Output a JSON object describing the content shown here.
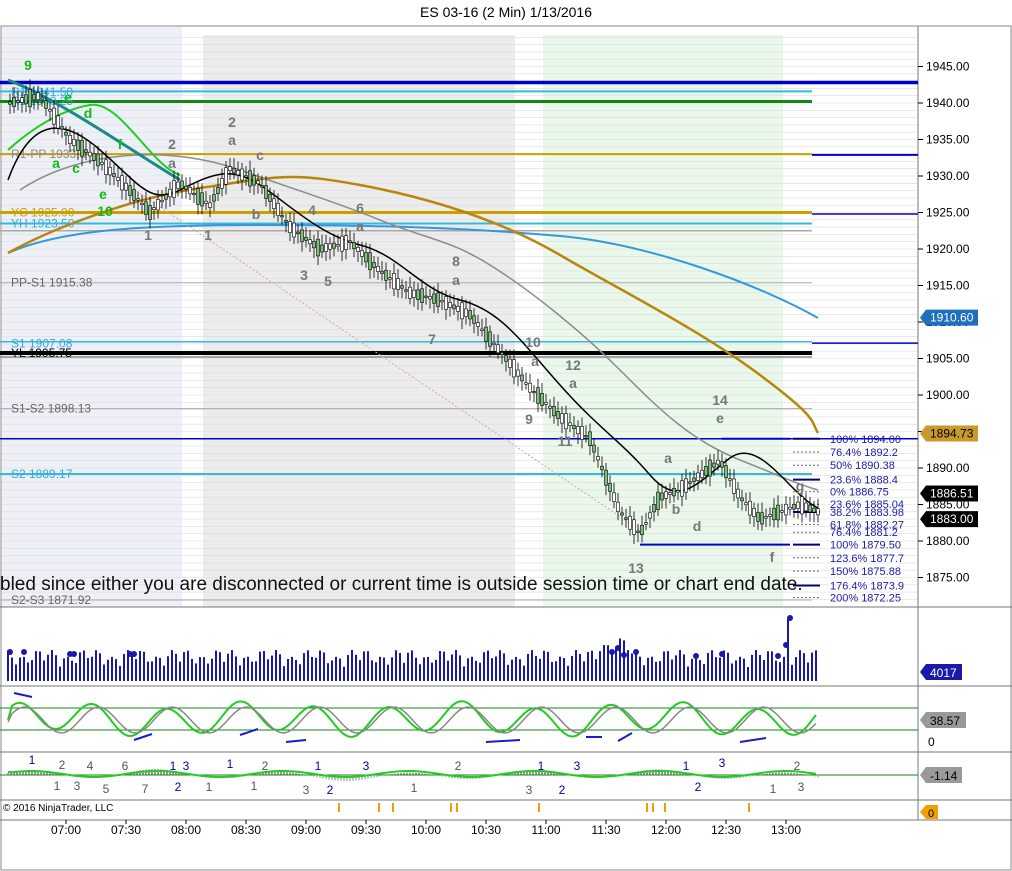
{
  "title": "ES 03-16 (2 Min)  1/13/2016",
  "copyright": "© 2016 NinjaTrader, LLC",
  "banner": "bled since either you are disconnected or current time is outside session time or chart end date.",
  "colors": {
    "up_candle": "#7fbf7f",
    "down_candle": "#ffffff",
    "ema_fast": "#000000",
    "ema_mid": "#8c8c8c",
    "ema_slow": "#b8860b",
    "ema_long": "#3399dd",
    "pivot": "#0000cc",
    "cyan": "#33bbdd",
    "dark_green": "#118811",
    "gold": "#c8a000",
    "volume": "#1a1aa8",
    "osc_green": "#22cc22",
    "osc_grey": "#888888"
  },
  "chart_data": {
    "type": "line",
    "title": "ES 03-16 (2 Min)  1/13/2016",
    "ylim": [
      1871.5,
      1949.5
    ],
    "x_ticks": [
      "07:00",
      "07:30",
      "08:00",
      "08:30",
      "09:00",
      "09:30",
      "10:00",
      "10:30",
      "11:00",
      "11:30",
      "12:00",
      "12:30",
      "13:00"
    ],
    "y_ticks": [
      "1945.00",
      "1940.00",
      "1935.00",
      "1930.00",
      "1925.00",
      "1920.00",
      "1915.00",
      "1910.00",
      "1905.00",
      "1900.00",
      "1895.00",
      "1890.00",
      "1885.00",
      "1880.00",
      "1875.00"
    ],
    "price_markers": [
      {
        "label": "1910.60",
        "value": 1910.6,
        "bg": "#1f6fbf",
        "fg": "#ffffff"
      },
      {
        "label": "1894.73",
        "value": 1894.73,
        "bg": "#c89a2a",
        "fg": "#000000"
      },
      {
        "label": "1886.51",
        "value": 1886.51,
        "bg": "#000000",
        "fg": "#ffffff"
      },
      {
        "label": "1883.00",
        "value": 1883.0,
        "bg": "#000000",
        "fg": "#ffffff"
      }
    ],
    "pivot_labels": [
      {
        "label": "R1 1941.50",
        "value": 1941.5,
        "color": "#33aadd"
      },
      {
        "label": "R1 1940.25",
        "value": 1940.25,
        "color": "#33aadd"
      },
      {
        "label": "R1-PP 1933.0",
        "value": 1933.0,
        "color": "#888888"
      },
      {
        "label": "YC 1925.00",
        "value": 1925.0,
        "color": "#c8a000"
      },
      {
        "label": "YH 1923.50",
        "value": 1923.5,
        "color": "#33aadd"
      },
      {
        "label": "PP-S1 1915.38",
        "value": 1915.38,
        "color": "#666666"
      },
      {
        "label": "S1 1907.08",
        "value": 1907.08,
        "color": "#33aadd"
      },
      {
        "label": "YL 1905.75",
        "value": 1905.75,
        "color": "#000000"
      },
      {
        "label": "S1-S2 1898.13",
        "value": 1898.13,
        "color": "#666666"
      },
      {
        "label": "S2 1889.17",
        "value": 1889.17,
        "color": "#33aadd"
      },
      {
        "label": "S2-S3 1871.92",
        "value": 1871.92,
        "color": "#666666"
      }
    ],
    "fib_levels": [
      {
        "label": "100%  1894.00",
        "value": 1894.0
      },
      {
        "label": "76.4%  1892.2",
        "value": 1892.2
      },
      {
        "label": "50%  1890.38",
        "value": 1890.38
      },
      {
        "label": "23.6%  1888.4",
        "value": 1888.4
      },
      {
        "label": "0%  1886.75",
        "value": 1886.75
      },
      {
        "label": "23.6%  1885.04",
        "value": 1885.04
      },
      {
        "label": "38.2%  1883.98",
        "value": 1883.98
      },
      {
        "label": "61.8%  1882.27",
        "value": 1882.27
      },
      {
        "label": "76.4%  1881.2",
        "value": 1881.2
      },
      {
        "label": "100%  1879.50",
        "value": 1879.5
      },
      {
        "label": "123.6%  1877.7",
        "value": 1877.7
      },
      {
        "label": "150%  1875.88",
        "value": 1875.88
      },
      {
        "label": "176.4%  1873.9",
        "value": 1873.9
      },
      {
        "label": "200%  1872.25",
        "value": 1872.25
      }
    ],
    "wave_labels": [
      {
        "t": "9",
        "x": 28,
        "y": 70,
        "c": "#11bb11"
      },
      {
        "t": "e",
        "x": 68,
        "y": 102,
        "c": "#11bb11"
      },
      {
        "t": "d",
        "x": 88,
        "y": 118,
        "c": "#11bb11"
      },
      {
        "t": "a",
        "x": 56,
        "y": 168,
        "c": "#11bb11"
      },
      {
        "t": "c",
        "x": 76,
        "y": 173,
        "c": "#11bb11"
      },
      {
        "t": "f",
        "x": 120,
        "y": 149,
        "c": "#11bb11"
      },
      {
        "t": "e",
        "x": 103,
        "y": 199,
        "c": "#11bb11"
      },
      {
        "t": "10",
        "x": 105,
        "y": 216,
        "c": "#11bb11"
      },
      {
        "t": "2",
        "x": 172,
        "y": 149,
        "c": "#777777"
      },
      {
        "t": "a",
        "x": 172,
        "y": 168,
        "c": "#777777"
      },
      {
        "t": "1",
        "x": 148,
        "y": 240,
        "c": "#777777"
      },
      {
        "t": "2",
        "x": 232,
        "y": 127,
        "c": "#777777"
      },
      {
        "t": "a",
        "x": 232,
        "y": 145,
        "c": "#777777"
      },
      {
        "t": "c",
        "x": 260,
        "y": 160,
        "c": "#777777"
      },
      {
        "t": "b",
        "x": 256,
        "y": 219,
        "c": "#777777"
      },
      {
        "t": "1",
        "x": 208,
        "y": 240,
        "c": "#777777"
      },
      {
        "t": "4",
        "x": 312,
        "y": 215,
        "c": "#777777"
      },
      {
        "t": "6",
        "x": 360,
        "y": 213,
        "c": "#777777"
      },
      {
        "t": "a",
        "x": 360,
        "y": 231,
        "c": "#777777"
      },
      {
        "t": "3",
        "x": 304,
        "y": 280,
        "c": "#777777"
      },
      {
        "t": "5",
        "x": 328,
        "y": 286,
        "c": "#777777"
      },
      {
        "t": "8",
        "x": 456,
        "y": 266,
        "c": "#777777"
      },
      {
        "t": "a",
        "x": 456,
        "y": 285,
        "c": "#777777"
      },
      {
        "t": "7",
        "x": 432,
        "y": 344,
        "c": "#777777"
      },
      {
        "t": "10",
        "x": 533,
        "y": 347,
        "c": "#777777"
      },
      {
        "t": "a",
        "x": 535,
        "y": 366,
        "c": "#777777"
      },
      {
        "t": "12",
        "x": 573,
        "y": 370,
        "c": "#777777"
      },
      {
        "t": "a",
        "x": 573,
        "y": 388,
        "c": "#777777"
      },
      {
        "t": "9",
        "x": 529,
        "y": 424,
        "c": "#777777"
      },
      {
        "t": "11",
        "x": 565,
        "y": 446,
        "c": "#777777"
      },
      {
        "t": "14",
        "x": 720,
        "y": 405,
        "c": "#777777"
      },
      {
        "t": "e",
        "x": 720,
        "y": 423,
        "c": "#777777"
      },
      {
        "t": "a",
        "x": 668,
        "y": 463,
        "c": "#777777"
      },
      {
        "t": "b",
        "x": 676,
        "y": 514,
        "c": "#777777"
      },
      {
        "t": "d",
        "x": 697,
        "y": 531,
        "c": "#777777"
      },
      {
        "t": "g",
        "x": 800,
        "y": 491,
        "c": "#777777"
      },
      {
        "t": "f",
        "x": 772,
        "y": 562,
        "c": "#777777"
      },
      {
        "t": "13",
        "x": 636,
        "y": 573,
        "c": "#777777"
      }
    ],
    "volume": {
      "last_label": "4017",
      "last_value": 4017
    },
    "oscillator": {
      "last_label": "38.57",
      "last_value": 38.57,
      "zero_label": "0"
    },
    "momentum": {
      "last_label": "-1.14",
      "last_value": -1.14,
      "labels": [
        {
          "t": "1",
          "x": 32,
          "y": 764,
          "c": "#0000aa"
        },
        {
          "t": "2",
          "x": 62,
          "y": 769,
          "c": "#555555"
        },
        {
          "t": "4",
          "x": 90,
          "y": 770,
          "c": "#555555"
        },
        {
          "t": "6",
          "x": 125,
          "y": 770,
          "c": "#555555"
        },
        {
          "t": "1",
          "x": 57,
          "y": 790,
          "c": "#555555"
        },
        {
          "t": "3",
          "x": 77,
          "y": 790,
          "c": "#555555"
        },
        {
          "t": "5",
          "x": 106,
          "y": 793,
          "c": "#555555"
        },
        {
          "t": "7",
          "x": 145,
          "y": 793,
          "c": "#555555"
        },
        {
          "t": "1",
          "x": 173,
          "y": 770,
          "c": "#0000aa"
        },
        {
          "t": "3",
          "x": 186,
          "y": 770,
          "c": "#0000aa"
        },
        {
          "t": "2",
          "x": 178,
          "y": 791,
          "c": "#0000aa"
        },
        {
          "t": "1",
          "x": 209,
          "y": 791,
          "c": "#555555"
        },
        {
          "t": "1",
          "x": 230,
          "y": 768,
          "c": "#0000aa"
        },
        {
          "t": "2",
          "x": 265,
          "y": 770,
          "c": "#555555"
        },
        {
          "t": "1",
          "x": 254,
          "y": 790,
          "c": "#555555"
        },
        {
          "t": "1",
          "x": 318,
          "y": 770,
          "c": "#0000aa"
        },
        {
          "t": "3",
          "x": 366,
          "y": 770,
          "c": "#0000aa"
        },
        {
          "t": "3",
          "x": 306,
          "y": 794,
          "c": "#555555"
        },
        {
          "t": "2",
          "x": 330,
          "y": 794,
          "c": "#0000aa"
        },
        {
          "t": "1",
          "x": 414,
          "y": 792,
          "c": "#555555"
        },
        {
          "t": "2",
          "x": 458,
          "y": 770,
          "c": "#555555"
        },
        {
          "t": "3",
          "x": 529,
          "y": 794,
          "c": "#555555"
        },
        {
          "t": "1",
          "x": 541,
          "y": 770,
          "c": "#0000aa"
        },
        {
          "t": "3",
          "x": 577,
          "y": 770,
          "c": "#0000aa"
        },
        {
          "t": "2",
          "x": 562,
          "y": 794,
          "c": "#0000aa"
        },
        {
          "t": "1",
          "x": 686,
          "y": 770,
          "c": "#0000aa"
        },
        {
          "t": "3",
          "x": 722,
          "y": 767,
          "c": "#0000aa"
        },
        {
          "t": "2",
          "x": 698,
          "y": 791,
          "c": "#0000aa"
        },
        {
          "t": "2",
          "x": 797,
          "y": 770,
          "c": "#555555"
        },
        {
          "t": "1",
          "x": 773,
          "y": 793,
          "c": "#555555"
        },
        {
          "t": "3",
          "x": 801,
          "y": 791,
          "c": "#555555"
        }
      ]
    },
    "bottom_marker": {
      "label": "0"
    }
  }
}
